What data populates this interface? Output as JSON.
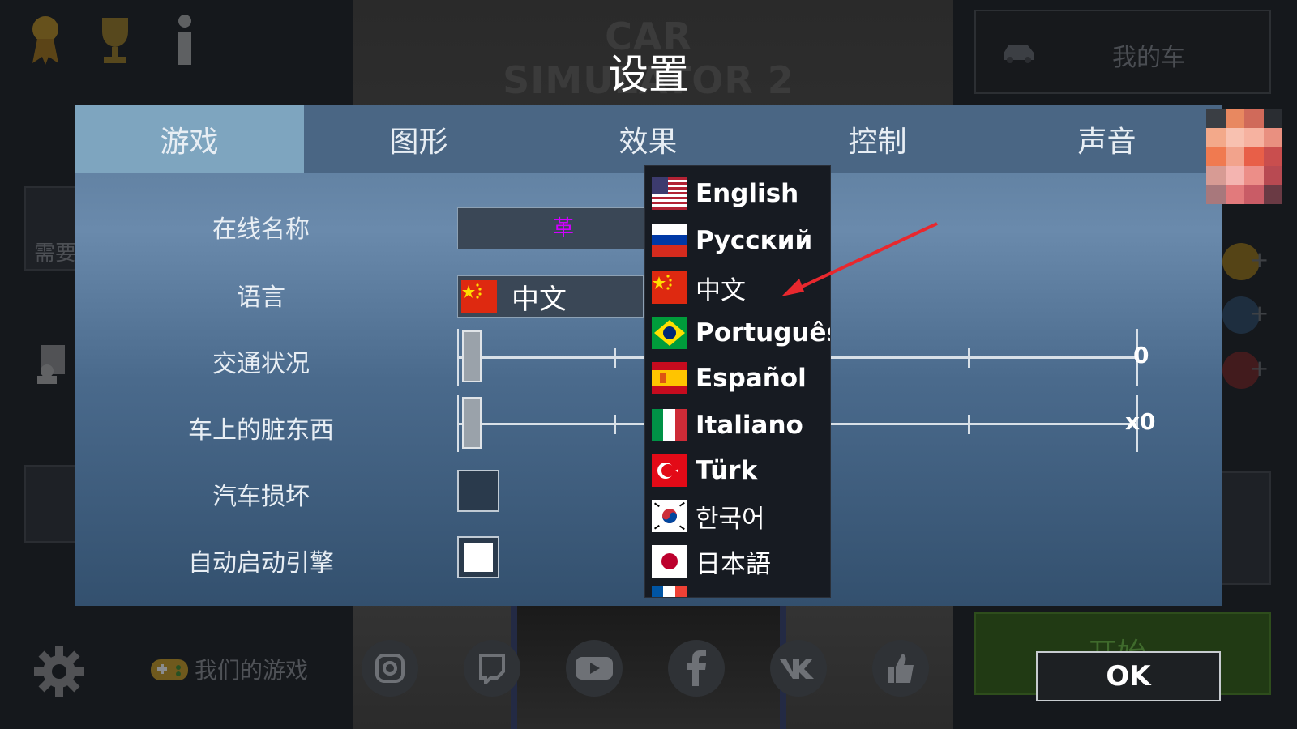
{
  "background": {
    "game_logo": "CAR SIMULATOR 2",
    "my_car_label": "我的车",
    "need_label": "需要",
    "start_label": "开始",
    "our_games_label": "我们的游戏",
    "icons": [
      "medal-icon",
      "trophy-icon",
      "info-icon",
      "car-icon",
      "report-icon",
      "coin-icon",
      "settings-gear-icon",
      "gamepad-icon"
    ],
    "social_icons": [
      "instagram-icon",
      "twitch-icon",
      "youtube-icon",
      "facebook-icon",
      "vk-icon",
      "like-icon"
    ]
  },
  "dialog": {
    "title": "设置",
    "tabs": [
      {
        "label": "游戏",
        "active": true
      },
      {
        "label": "图形",
        "active": false
      },
      {
        "label": "效果",
        "active": false
      },
      {
        "label": "控制",
        "active": false
      },
      {
        "label": "声音",
        "active": false
      }
    ],
    "rows": {
      "online_name": {
        "label": "在线名称",
        "value": "革"
      },
      "language": {
        "label": "语言",
        "value": "中文",
        "flag": "china-flag-icon"
      },
      "traffic": {
        "label": "交通状况",
        "value": "0",
        "level": 0
      },
      "car_dirt": {
        "label": "车上的脏东西",
        "value": "x0",
        "level": 0
      },
      "car_damage": {
        "label": "汽车损坏",
        "checked": false
      },
      "auto_start": {
        "label": "自动启动引擎",
        "checked": true
      }
    }
  },
  "language_dropdown": {
    "options": [
      {
        "name": "English",
        "flag": "usa-flag-icon"
      },
      {
        "name": "Русский",
        "flag": "russia-flag-icon"
      },
      {
        "name": "中文",
        "flag": "china-flag-icon"
      },
      {
        "name": "Português",
        "flag": "brazil-flag-icon"
      },
      {
        "name": "Español",
        "flag": "spain-flag-icon"
      },
      {
        "name": "Italiano",
        "flag": "italy-flag-icon"
      },
      {
        "name": "Türk",
        "flag": "turkey-flag-icon"
      },
      {
        "name": "한국어",
        "flag": "korea-flag-icon"
      },
      {
        "name": "日本語",
        "flag": "japan-flag-icon"
      }
    ]
  },
  "ok_button": "OK",
  "colors": {
    "accent_arrow": "#e8282e",
    "active_tab": "#7ea5bf",
    "name_text": "#d000ff"
  }
}
